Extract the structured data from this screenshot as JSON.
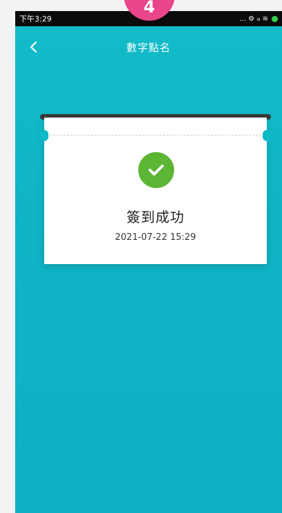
{
  "status_bar": {
    "time": "下午3:29",
    "icons_text": "... ⚙ ᵢₗₗ ≋"
  },
  "step_badge": "4",
  "nav": {
    "title": "數字點名",
    "back_icon": "chevron-left-icon"
  },
  "ticket": {
    "status_icon": "checkmark-icon",
    "success_text": "簽到成功",
    "timestamp": "2021-07-22 15:29"
  },
  "colors": {
    "background_teal": "#10b8c8",
    "badge_pink": "#e8458a",
    "success_green": "#5cb533"
  }
}
